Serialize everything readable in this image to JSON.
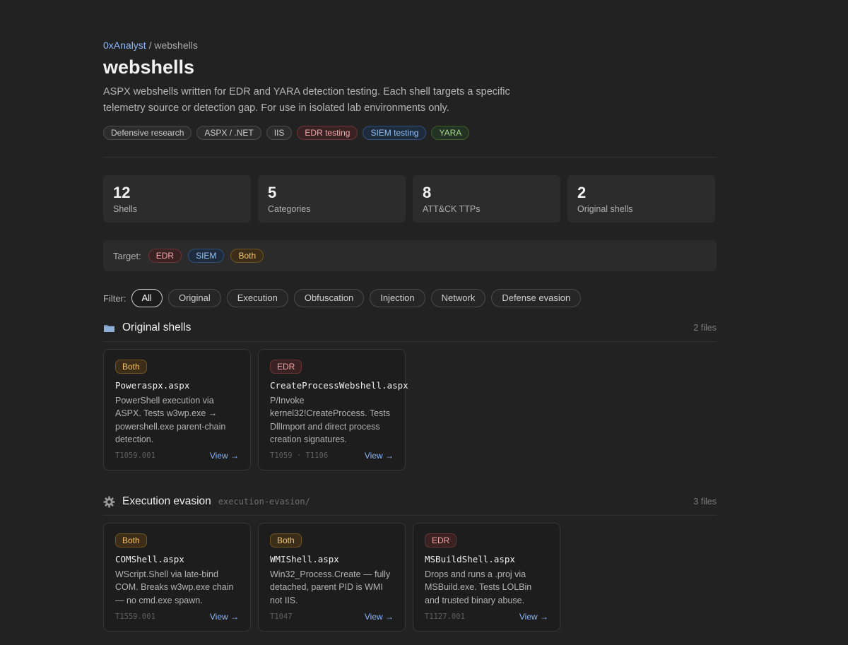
{
  "breadcrumb": {
    "owner": "0xAnalyst",
    "separator": " / ",
    "repo": "webshells"
  },
  "repo": {
    "title": "webshells",
    "description": "ASPX webshells written for EDR and YARA detection testing. Each shell targets a specific telemetry source or detection gap. For use in isolated lab environments only."
  },
  "tags": [
    {
      "label": "Defensive research",
      "style": "neutral"
    },
    {
      "label": "ASPX / .NET",
      "style": "neutral"
    },
    {
      "label": "IIS",
      "style": "neutral"
    },
    {
      "label": "EDR testing",
      "style": "red"
    },
    {
      "label": "SIEM testing",
      "style": "blue"
    },
    {
      "label": "YARA",
      "style": "green"
    }
  ],
  "stats": [
    {
      "value": "12",
      "label": "Shells"
    },
    {
      "value": "5",
      "label": "Categories"
    },
    {
      "value": "8",
      "label": "ATT&CK TTPs"
    },
    {
      "value": "2",
      "label": "Original shells"
    }
  ],
  "target": {
    "label": "Target:",
    "options": [
      {
        "label": "EDR",
        "style": "red"
      },
      {
        "label": "SIEM",
        "style": "blue"
      },
      {
        "label": "Both",
        "style": "amber"
      }
    ]
  },
  "filter": {
    "label": "Filter:",
    "selected": "All",
    "options": [
      "All",
      "Original",
      "Execution",
      "Obfuscation",
      "Injection",
      "Network",
      "Defense evasion"
    ]
  },
  "sections": [
    {
      "icon": "folder-icon",
      "title": "Original shells",
      "path": "",
      "count": "2 files",
      "cards": [
        {
          "badge": "Both",
          "badge_style": "amber",
          "file": "Poweraspx.aspx",
          "description": "PowerShell execution via ASPX. Tests w3wp.exe → powershell.exe parent-chain detection.",
          "ttps": "T1059.001",
          "view": "View →"
        },
        {
          "badge": "EDR",
          "badge_style": "red",
          "file": "CreateProcessWebshell.aspx",
          "description": "P/Invoke kernel32!CreateProcess. Tests DllImport and direct process creation signatures.",
          "ttps": "T1059 · T1106",
          "view": "View →"
        }
      ]
    },
    {
      "icon": "gear-icon",
      "title": "Execution evasion",
      "path": "execution-evasion/",
      "count": "3 files",
      "cards": [
        {
          "badge": "Both",
          "badge_style": "amber",
          "file": "COMShell.aspx",
          "description": "WScript.Shell via late-bind COM. Breaks w3wp.exe chain — no cmd.exe spawn.",
          "ttps": "T1559.001",
          "view": "View →"
        },
        {
          "badge": "Both",
          "badge_style": "amber",
          "file": "WMIShell.aspx",
          "description": "Win32_Process.Create — fully detached, parent PID is WMI not IIS.",
          "ttps": "T1047",
          "view": "View →"
        },
        {
          "badge": "EDR",
          "badge_style": "red",
          "file": "MSBuildShell.aspx",
          "description": "Drops and runs a .proj via MSBuild.exe. Tests LOLBin and trusted binary abuse.",
          "ttps": "T1127.001",
          "view": "View →"
        }
      ]
    }
  ]
}
